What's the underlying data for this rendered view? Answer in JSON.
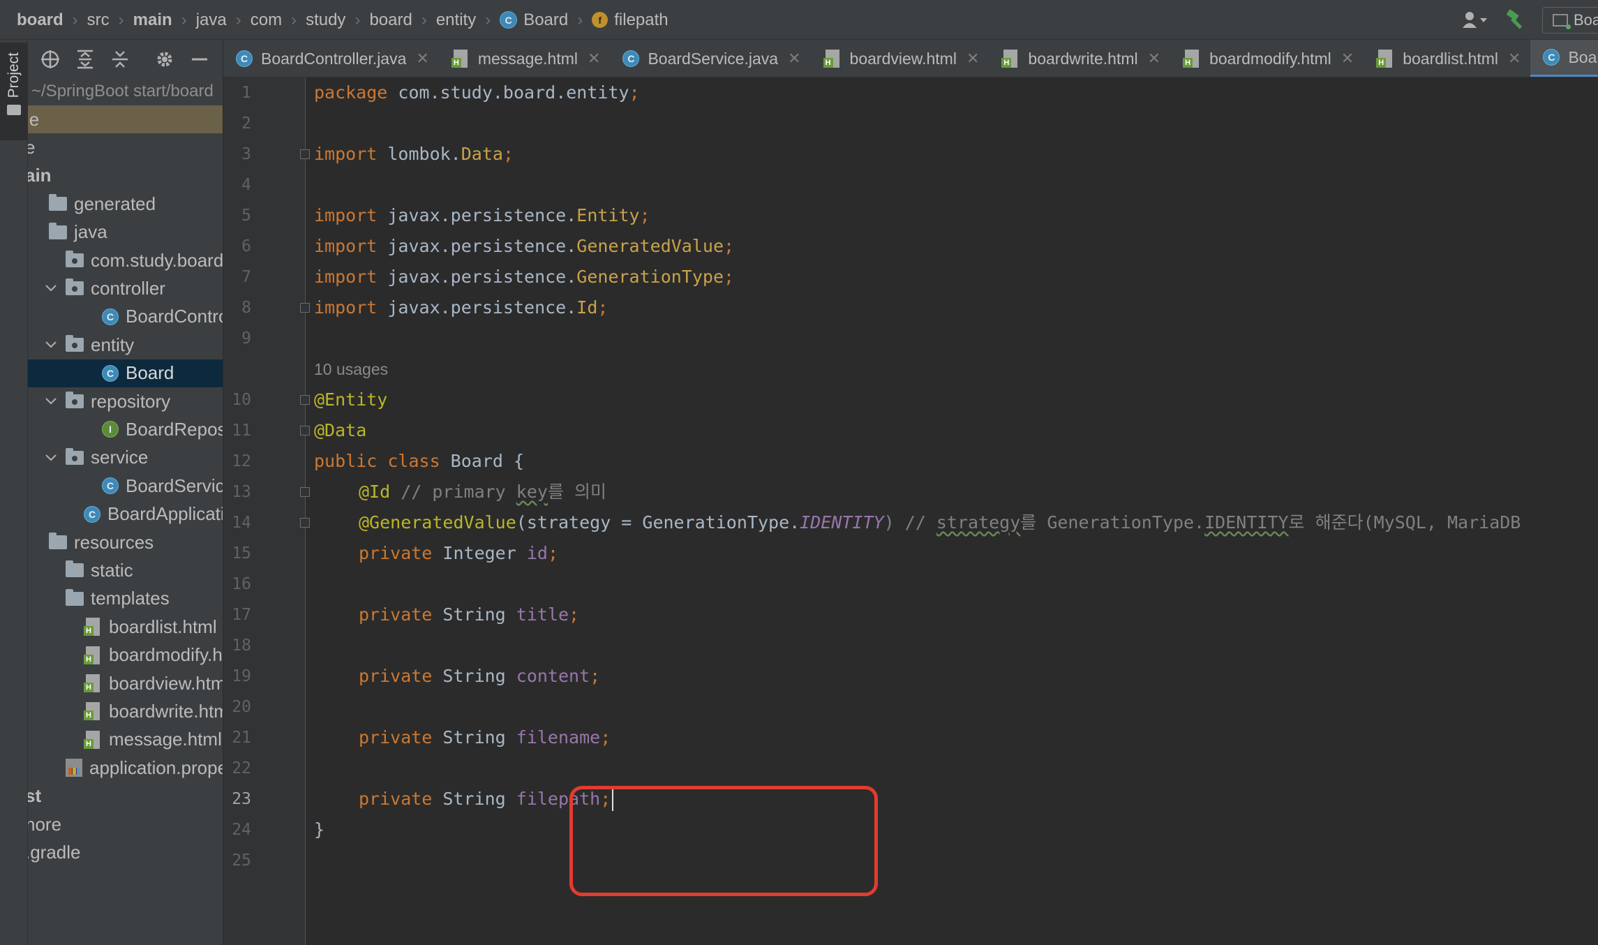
{
  "breadcrumb": [
    {
      "label": "board",
      "bold": true,
      "icon": null
    },
    {
      "label": "src",
      "bold": false,
      "icon": null
    },
    {
      "label": "main",
      "bold": true,
      "icon": null
    },
    {
      "label": "java",
      "bold": false,
      "icon": null
    },
    {
      "label": "com",
      "bold": false,
      "icon": null
    },
    {
      "label": "study",
      "bold": false,
      "icon": null
    },
    {
      "label": "board",
      "bold": false,
      "icon": null
    },
    {
      "label": "entity",
      "bold": false,
      "icon": null
    },
    {
      "label": "Board",
      "bold": false,
      "icon": "class-icon"
    },
    {
      "label": "filepath",
      "bold": false,
      "icon": "field-icon"
    }
  ],
  "nav_right": {
    "run_config_label": "Boa",
    "user_icon": "user-dropdown-icon",
    "build_icon": "hammer-icon"
  },
  "tool_strip": {
    "project_tab_label": "Project"
  },
  "project_panel": {
    "toolbar_icons": [
      "target-icon",
      "expand-all-icon",
      "collapse-all-icon",
      "gear-icon",
      "minimize-icon"
    ],
    "path_label": "~/SpringBoot start/board",
    "tree": [
      {
        "label": "le",
        "indent": 0,
        "icon": null,
        "arrow": "",
        "state": "highlight"
      },
      {
        "label": "e",
        "indent": 0,
        "icon": null,
        "arrow": "",
        "state": ""
      },
      {
        "label": "ain",
        "indent": 0,
        "icon": null,
        "arrow": "",
        "state": "bold"
      },
      {
        "label": "generated",
        "indent": 0,
        "icon": "folder",
        "arrow": "",
        "state": ""
      },
      {
        "label": "java",
        "indent": 0,
        "icon": "folder",
        "arrow": "",
        "state": ""
      },
      {
        "label": "com.study.board",
        "indent": 1,
        "icon": "package",
        "arrow": "",
        "state": ""
      },
      {
        "label": "controller",
        "indent": 1,
        "icon": "package",
        "arrow": "v",
        "state": ""
      },
      {
        "label": "BoardControl",
        "indent": 3,
        "icon": "class",
        "arrow": "",
        "state": ""
      },
      {
        "label": "entity",
        "indent": 1,
        "icon": "package",
        "arrow": "v",
        "state": ""
      },
      {
        "label": "Board",
        "indent": 3,
        "icon": "class",
        "arrow": "",
        "state": "selected"
      },
      {
        "label": "repository",
        "indent": 1,
        "icon": "package",
        "arrow": "v",
        "state": ""
      },
      {
        "label": "BoardReposit",
        "indent": 3,
        "icon": "interface",
        "arrow": "",
        "state": ""
      },
      {
        "label": "service",
        "indent": 1,
        "icon": "package",
        "arrow": "v",
        "state": ""
      },
      {
        "label": "BoardService",
        "indent": 3,
        "icon": "class",
        "arrow": "",
        "state": ""
      },
      {
        "label": "BoardApplicatio",
        "indent": 2,
        "icon": "class",
        "arrow": "",
        "state": ""
      },
      {
        "label": "resources",
        "indent": 0,
        "icon": "folder",
        "arrow": "",
        "state": ""
      },
      {
        "label": "static",
        "indent": 1,
        "icon": "folder",
        "arrow": "",
        "state": ""
      },
      {
        "label": "templates",
        "indent": 1,
        "icon": "folder",
        "arrow": "",
        "state": ""
      },
      {
        "label": "boardlist.html",
        "indent": 2,
        "icon": "html",
        "arrow": "",
        "state": ""
      },
      {
        "label": "boardmodify.htm",
        "indent": 2,
        "icon": "html",
        "arrow": "",
        "state": ""
      },
      {
        "label": "boardview.html",
        "indent": 2,
        "icon": "html",
        "arrow": "",
        "state": ""
      },
      {
        "label": "boardwrite.html",
        "indent": 2,
        "icon": "html",
        "arrow": "",
        "state": ""
      },
      {
        "label": "message.html",
        "indent": 2,
        "icon": "html",
        "arrow": "",
        "state": ""
      },
      {
        "label": "application.propert",
        "indent": 1,
        "icon": "props",
        "arrow": "",
        "state": ""
      },
      {
        "label": "st",
        "indent": 0,
        "icon": null,
        "arrow": "",
        "state": "bold"
      },
      {
        "label": "nore",
        "indent": 0,
        "icon": null,
        "arrow": "",
        "state": ""
      },
      {
        "label": ".gradle",
        "indent": 0,
        "icon": null,
        "arrow": "",
        "state": ""
      }
    ]
  },
  "tabs": [
    {
      "label": "BoardController.java",
      "icon": "class",
      "active": false
    },
    {
      "label": "message.html",
      "icon": "html",
      "active": false
    },
    {
      "label": "BoardService.java",
      "icon": "class",
      "active": false
    },
    {
      "label": "boardview.html",
      "icon": "html",
      "active": false
    },
    {
      "label": "boardwrite.html",
      "icon": "html",
      "active": false
    },
    {
      "label": "boardmodify.html",
      "icon": "html",
      "active": false
    },
    {
      "label": "boardlist.html",
      "icon": "html",
      "active": false
    },
    {
      "label": "Board.java",
      "icon": "class",
      "active": true
    }
  ],
  "editor": {
    "current_line": 23,
    "line_numbers": [
      "1",
      "2",
      "3",
      "4",
      "5",
      "6",
      "7",
      "8",
      "9",
      "10",
      "11",
      "12",
      "13",
      "14",
      "15",
      "16",
      "17",
      "18",
      "19",
      "20",
      "21",
      "22",
      "23",
      "24",
      "25"
    ],
    "usages_hint": "10 usages",
    "lines": {
      "l1": [
        "package com.study.board.entity",
        ";"
      ],
      "l3": [
        "import ",
        "lombok.",
        "Data",
        ";"
      ],
      "l5": [
        "import ",
        "javax.persistence.",
        "Entity",
        ";"
      ],
      "l6": [
        "import ",
        "javax.persistence.",
        "GeneratedValue",
        ";"
      ],
      "l7": [
        "import ",
        "javax.persistence.",
        "GenerationType",
        ";"
      ],
      "l8": [
        "import ",
        "javax.persistence.",
        "Id",
        ";"
      ],
      "l10": "@Entity",
      "l11": "@Data",
      "l12": [
        "public class ",
        "Board {"
      ],
      "l13": [
        "@Id",
        " // primary ",
        "key",
        "를 의미"
      ],
      "l14": [
        "@GeneratedValue",
        "(strategy = GenerationType.",
        "IDENTITY",
        ") // ",
        "strategy",
        "를 GenerationType.",
        "IDENTITY",
        "로 해준다(MySQL, MariaDB"
      ],
      "l15": [
        "private ",
        "Integer ",
        "id",
        ";"
      ],
      "l17": [
        "private ",
        "String ",
        "title",
        ";"
      ],
      "l19": [
        "private ",
        "String ",
        "content",
        ";"
      ],
      "l21": [
        "private ",
        "String ",
        "filename",
        ";"
      ],
      "l23": [
        "private ",
        "String ",
        "filepath",
        ";"
      ],
      "l24": "}"
    },
    "highlight_color": "#e33b2f"
  },
  "colors": {
    "keyword": "#cc7832",
    "annotation": "#bbb529",
    "field": "#9876aa",
    "comment": "#808080",
    "selection": "#0d293e",
    "active_tab_underline": "#4a88c7"
  }
}
